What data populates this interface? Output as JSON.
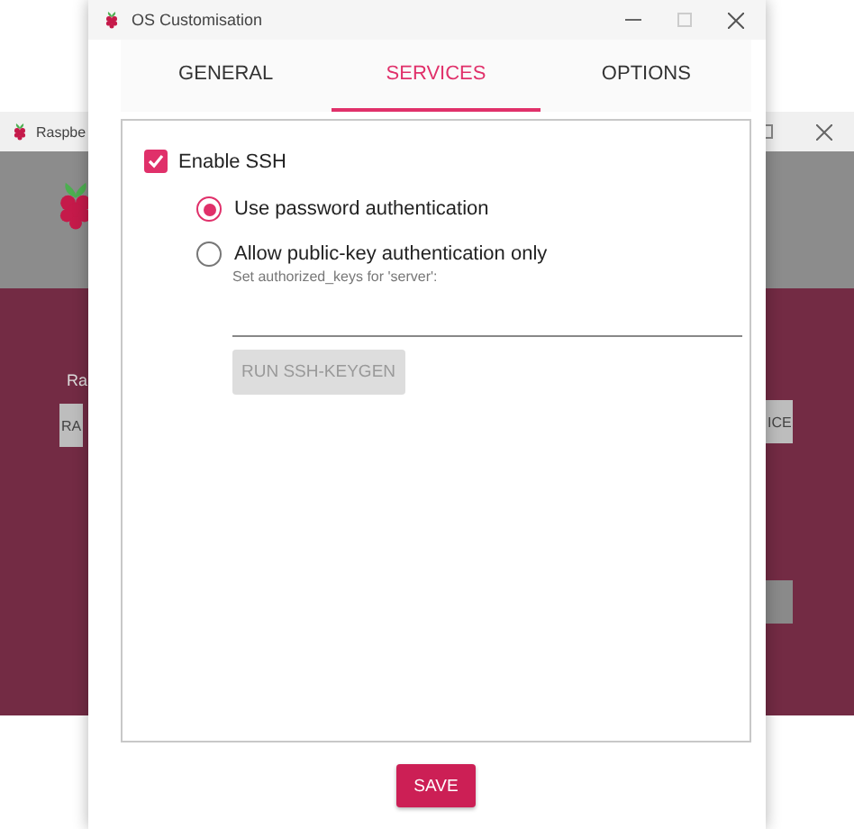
{
  "background_window": {
    "title": "Raspbe",
    "label": "Ra",
    "buttons": [
      "RA",
      "ICE"
    ]
  },
  "dialog": {
    "title": "OS Customisation",
    "tabs": [
      {
        "label": "GENERAL",
        "selected": false
      },
      {
        "label": "SERVICES",
        "selected": true
      },
      {
        "label": "OPTIONS",
        "selected": false
      }
    ],
    "enable_ssh": {
      "label": "Enable SSH",
      "checked": true
    },
    "auth_options": [
      {
        "label": "Use password authentication",
        "selected": true
      },
      {
        "label": "Allow public-key authentication only",
        "selected": false
      }
    ],
    "keys_field": {
      "label": "Set authorized_keys for 'server':"
    },
    "keygen_button": {
      "label": "RUN SSH-KEYGEN",
      "disabled": true
    },
    "save_button": "SAVE"
  }
}
